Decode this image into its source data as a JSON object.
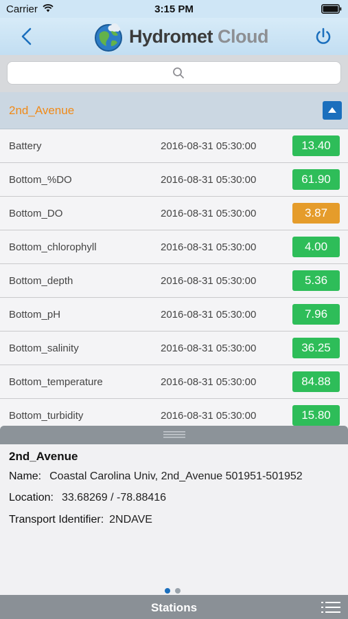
{
  "status_bar": {
    "carrier": "Carrier",
    "time": "3:15 PM"
  },
  "header": {
    "logo_main": "Hydromet",
    "logo_sub": "Cloud"
  },
  "search": {
    "placeholder": ""
  },
  "station": {
    "name": "2nd_Avenue"
  },
  "colors": {
    "green": "#2ebd59",
    "orange": "#e59c2b",
    "accent": "#1b6fbd",
    "title_orange": "#f08a18"
  },
  "sensors": [
    {
      "name": "Battery",
      "time": "2016-08-31 05:30:00",
      "value": "13.40",
      "status": "green"
    },
    {
      "name": "Bottom_%DO",
      "time": "2016-08-31 05:30:00",
      "value": "61.90",
      "status": "green"
    },
    {
      "name": "Bottom_DO",
      "time": "2016-08-31 05:30:00",
      "value": "3.87",
      "status": "orange"
    },
    {
      "name": "Bottom_chlorophyll",
      "time": "2016-08-31 05:30:00",
      "value": "4.00",
      "status": "green"
    },
    {
      "name": "Bottom_depth",
      "time": "2016-08-31 05:30:00",
      "value": "5.36",
      "status": "green"
    },
    {
      "name": "Bottom_pH",
      "time": "2016-08-31 05:30:00",
      "value": "7.96",
      "status": "green"
    },
    {
      "name": "Bottom_salinity",
      "time": "2016-08-31 05:30:00",
      "value": "36.25",
      "status": "green"
    },
    {
      "name": "Bottom_temperature",
      "time": "2016-08-31 05:30:00",
      "value": "84.88",
      "status": "green"
    },
    {
      "name": "Bottom_turbidity",
      "time": "2016-08-31 05:30:00",
      "value": "15.80",
      "status": "green"
    }
  ],
  "detail_panel": {
    "title": "2nd_Avenue",
    "name_label": "Name:",
    "name_value": "Coastal Carolina Univ, 2nd_Avenue 501951-501952",
    "location_label": "Location:",
    "location_value": "33.68269 / -78.88416",
    "transport_label": "Transport Identifier:",
    "transport_value": "2NDAVE",
    "page_count": 2,
    "current_page": 1
  },
  "bottom_bar": {
    "label": "Stations"
  }
}
